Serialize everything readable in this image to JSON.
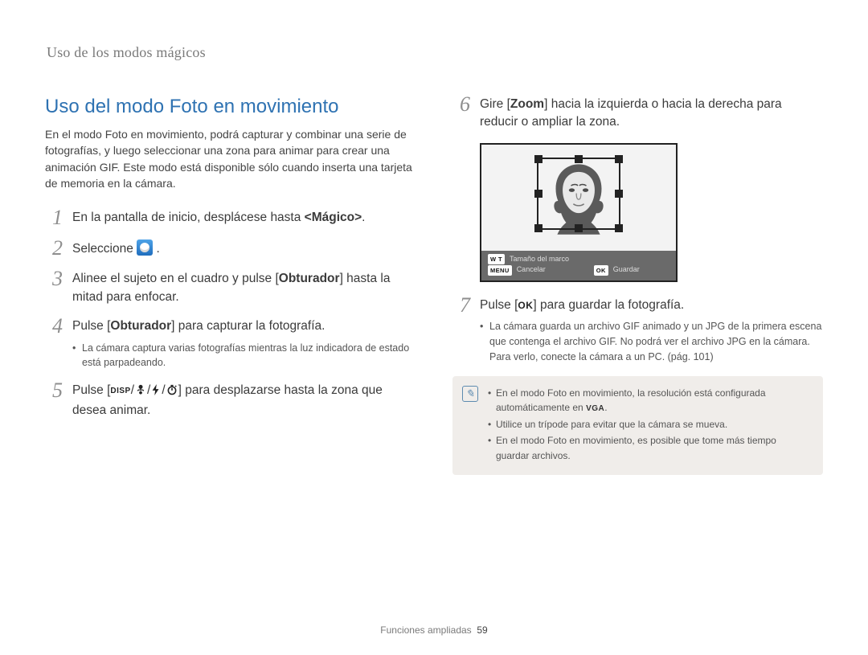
{
  "breadcrumb": "Uso de los modos mágicos",
  "sectionTitle": "Uso del modo Foto en movimiento",
  "intro": "En el modo Foto en movimiento, podrá capturar y combinar una serie de fotografías, y luego seleccionar una zona para animar para crear una animación GIF. Este modo está disponible sólo cuando inserta una tarjeta de memoria en la cámara.",
  "leftSteps": {
    "s1": {
      "num": "1",
      "pre": "En la pantalla de inicio, desplácese hasta ",
      "bold": "<Mágico>",
      "post": "."
    },
    "s2": {
      "num": "2",
      "pre": "Seleccione ",
      "post": " ."
    },
    "s3": {
      "num": "3",
      "pre": "Alinee el sujeto en el cuadro y pulse [",
      "bold": "Obturador",
      "post": "] hasta la mitad para enfocar."
    },
    "s4": {
      "num": "4",
      "pre": "Pulse [",
      "bold": "Obturador",
      "post": "] para capturar la fotografía.",
      "sub1": "La cámara captura varias fotografías mientras la luz indicadora de estado está parpadeando."
    },
    "s5": {
      "num": "5",
      "pre": "Pulse [",
      "post": "] para desplazarse hasta la zona que desea animar."
    }
  },
  "rightSteps": {
    "s6": {
      "num": "6",
      "pre": "Gire [",
      "bold": "Zoom",
      "post": "] hacia la izquierda o hacia la derecha para reducir o ampliar la zona."
    },
    "s7": {
      "num": "7",
      "pre": "Pulse [",
      "post": "] para guardar la fotografía.",
      "sub1": "La cámara guarda un archivo GIF animado y un JPG de la primera escena que contenga el archivo GIF. No podrá ver el archivo JPG en la cámara. Para verlo, conecte la cámara a un PC. (pág. 101)"
    }
  },
  "shotBar": {
    "wt": "W T",
    "frameSize": "Tamaño del marco",
    "menu": "MENU",
    "cancel": "Cancelar",
    "ok": "OK",
    "save": "Guardar"
  },
  "notes": {
    "n1a": "En el modo Foto en movimiento, la resolución está configurada automáticamente en ",
    "n1vga": "VGA",
    "n1b": ".",
    "n2": "Utilice un trípode para evitar que la cámara se mueva.",
    "n3": "En el modo Foto en movimiento, es posible que tome más tiempo guardar archivos."
  },
  "icons": {
    "disp": "DISP",
    "ok": "OK"
  },
  "footer": {
    "label": "Funciones ampliadas",
    "page": "59"
  }
}
